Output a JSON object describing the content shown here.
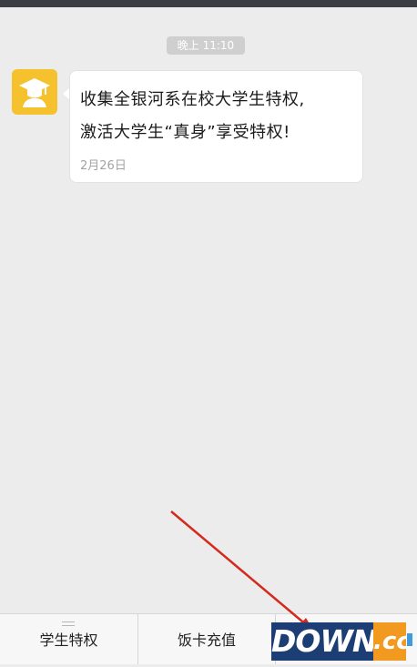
{
  "chat": {
    "timestamp": "晚上 11:10",
    "message": {
      "line1": "收集全银河系在校大学生特权,",
      "line2": "激活大学生“真身”享受特权!",
      "date": "2月26日"
    },
    "sender_avatar_icon": "graduate-cap-icon"
  },
  "bottom_menu": {
    "items": [
      {
        "label": "学生特权",
        "icon": "menu-lines-icon"
      },
      {
        "label": "饭卡充值"
      },
      {
        "label": ""
      }
    ]
  },
  "annotation": {
    "type": "red-arrow",
    "color": "#d42a1e"
  },
  "watermark": {
    "text1": "DOWN",
    "text2": ".cc"
  },
  "colors": {
    "background": "#ececec",
    "avatar": "#f5c12c",
    "watermark_blue": "#1c3e74",
    "watermark_orange": "#f29a1f"
  }
}
